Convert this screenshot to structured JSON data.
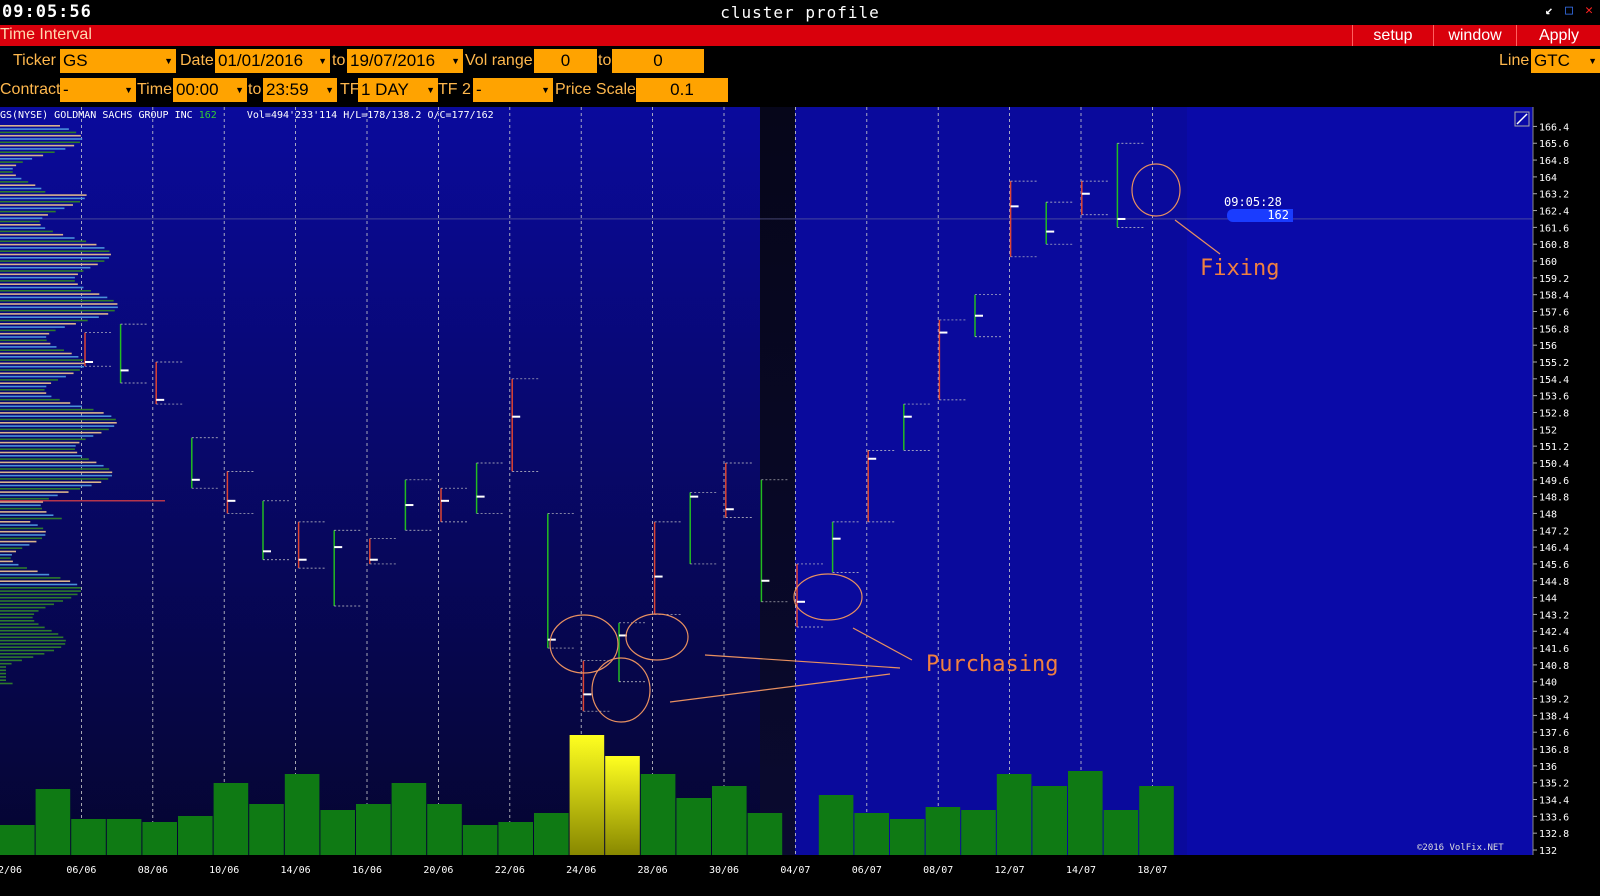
{
  "window": {
    "clock": "09:05:56",
    "title": "cluster profile"
  },
  "menubar": {
    "label": "Time Interval",
    "buttons": [
      "setup",
      "window",
      "Apply"
    ]
  },
  "params": {
    "ticker_label": "Ticker",
    "ticker": "GS",
    "date_label": "Date",
    "date_from": "01/01/2016",
    "to_label": "to",
    "date_to": "19/07/2016",
    "volrange_label": "Vol range",
    "vol_from": "0",
    "vol_to": "0",
    "line_label": "Line",
    "line": "GTC",
    "contract_label": "Contract",
    "contract": "-",
    "time_label": "Time",
    "time_from": "00:00",
    "time_to": "23:59",
    "tf_label": "TF",
    "tf": "1 DAY",
    "tf2_label": "TF 2",
    "tf2": "-",
    "pricescale_label": "Price Scale",
    "pricescale": "0.1"
  },
  "info": {
    "symbol": "GS(NYSE) GOLDMAN SACHS GROUP INC",
    "last": "162",
    "stats": "Vol=494'233'114 H/L=178/138.2 O/C=177/162"
  },
  "overlay": {
    "time": "09:05:28",
    "price": "162",
    "fixing": "Fixing",
    "purchasing": "Purchasing",
    "copyright": "©2016 VolFix.NET"
  },
  "colors": {
    "bg_blue": "#0a0a9c",
    "bg_dark": "#05051a",
    "volume_green": "#0f7a14",
    "volume_yellow": "#f0f000",
    "accent": "#ffa300",
    "menu_red": "#d9000c"
  },
  "chart_data": {
    "type": "bar",
    "xlabels": [
      "2/06",
      "06/06",
      "08/06",
      "10/06",
      "14/06",
      "16/06",
      "20/06",
      "22/06",
      "24/06",
      "28/06",
      "30/06",
      "04/07",
      "06/07",
      "08/07",
      "12/07",
      "14/07",
      "18/07"
    ],
    "price_ticks": [
      166.4,
      165.6,
      164.8,
      164,
      163.2,
      162.4,
      161.6,
      160.8,
      160,
      159.2,
      158.4,
      157.6,
      156.8,
      156,
      155.2,
      154.4,
      153.6,
      152.8,
      152,
      151.2,
      150.4,
      149.6,
      148.8,
      148,
      147.2,
      146.4,
      145.6,
      144.8,
      144,
      143.2,
      142.4,
      141.6,
      140.8,
      140,
      139.2,
      138.4,
      137.6,
      136.8,
      136,
      135.2,
      134.4,
      133.6,
      132.8,
      132
    ],
    "ylim": [
      132,
      166.8
    ],
    "candles": [
      {
        "hi": 156.6,
        "lo": 155.0,
        "c": 155.2
      },
      {
        "hi": 157.0,
        "lo": 154.2,
        "c": 154.8
      },
      {
        "hi": 155.2,
        "lo": 153.2,
        "c": 153.4
      },
      {
        "hi": 151.6,
        "lo": 149.2,
        "c": 149.6
      },
      {
        "hi": 150.0,
        "lo": 148.0,
        "c": 148.6
      },
      {
        "hi": 148.6,
        "lo": 145.8,
        "c": 146.2
      },
      {
        "hi": 147.6,
        "lo": 145.4,
        "c": 145.8
      },
      {
        "hi": 147.2,
        "lo": 143.6,
        "c": 146.4
      },
      {
        "hi": 146.8,
        "lo": 145.6,
        "c": 145.8
      },
      {
        "hi": 149.6,
        "lo": 147.2,
        "c": 148.4
      },
      {
        "hi": 149.2,
        "lo": 147.6,
        "c": 148.6
      },
      {
        "hi": 150.4,
        "lo": 148.0,
        "c": 148.8
      },
      {
        "hi": 154.4,
        "lo": 150.0,
        "c": 152.6
      },
      {
        "hi": 148.0,
        "lo": 141.6,
        "c": 142.0
      },
      {
        "hi": 141.0,
        "lo": 138.6,
        "c": 139.4
      },
      {
        "hi": 142.8,
        "lo": 140.0,
        "c": 142.2
      },
      {
        "hi": 147.6,
        "lo": 143.2,
        "c": 145.0
      },
      {
        "hi": 149.0,
        "lo": 145.6,
        "c": 148.8
      },
      {
        "hi": 150.4,
        "lo": 147.8,
        "c": 148.2
      },
      {
        "hi": 149.6,
        "lo": 143.8,
        "c": 144.8
      },
      {
        "hi": 145.6,
        "lo": 142.6,
        "c": 143.8
      },
      {
        "hi": 147.6,
        "lo": 145.2,
        "c": 146.8
      },
      {
        "hi": 151.0,
        "lo": 147.6,
        "c": 150.6
      },
      {
        "hi": 153.2,
        "lo": 151.0,
        "c": 152.6
      },
      {
        "hi": 157.2,
        "lo": 153.4,
        "c": 156.6
      },
      {
        "hi": 158.4,
        "lo": 156.4,
        "c": 157.4
      },
      {
        "hi": 163.8,
        "lo": 160.2,
        "c": 162.6
      },
      {
        "hi": 162.8,
        "lo": 160.8,
        "c": 161.4
      },
      {
        "hi": 163.8,
        "lo": 162.2,
        "c": 163.2
      },
      {
        "hi": 165.6,
        "lo": 161.6,
        "c": 162.0
      }
    ],
    "volume": [
      10,
      22,
      12,
      12,
      11,
      13,
      24,
      17,
      27,
      15,
      17,
      24,
      17,
      10,
      11,
      14,
      40,
      33,
      27,
      19,
      23,
      14,
      0,
      20,
      14,
      12,
      16,
      15,
      27,
      23,
      28,
      15,
      23
    ],
    "volume_highlight": [
      16,
      17
    ]
  }
}
